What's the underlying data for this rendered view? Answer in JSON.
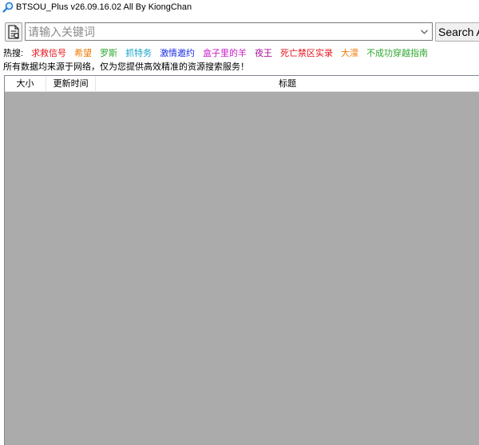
{
  "window": {
    "title": "BTSOU_Plus v26.09.16.02 All By KiongChan",
    "icon": "magnifier-icon"
  },
  "toolbar": {
    "doc_button_icon": "document-icon",
    "search_placeholder": "请输入关键词",
    "search_value": "",
    "dropdown_icon": "chevron-down-icon",
    "search_button_label": "Search A"
  },
  "hot": {
    "label": "热搜:",
    "items": [
      {
        "text": "求救信号",
        "color": "#e8141c"
      },
      {
        "text": "希望",
        "color": "#f07800"
      },
      {
        "text": "罗斯",
        "color": "#2ea82e"
      },
      {
        "text": "抓特务",
        "color": "#16a6c8"
      },
      {
        "text": "激情邀约",
        "color": "#1a2ee6"
      },
      {
        "text": "盒子里的羊",
        "color": "#c81ec8"
      },
      {
        "text": "夜王",
        "color": "#a8149a"
      },
      {
        "text": "死亡禁区实录",
        "color": "#e8141c"
      },
      {
        "text": "大濛",
        "color": "#f07800"
      },
      {
        "text": "不成功穿越指南",
        "color": "#2ea82e"
      }
    ]
  },
  "notice": "所有数据均来源于网络，仅为您提供高效精准的资源搜索服务！",
  "results": {
    "columns": [
      "大小",
      "更新时间",
      "标题"
    ],
    "rows": []
  }
}
